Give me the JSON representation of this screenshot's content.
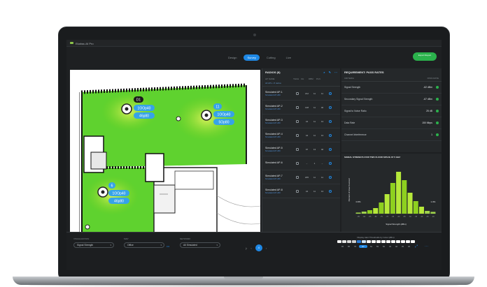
{
  "app": {
    "title": "Ekahau AI Pro"
  },
  "tabs": [
    {
      "label": "Design",
      "active": false
    },
    {
      "label": "Survey",
      "active": true
    },
    {
      "label": "Cutting",
      "active": false
    },
    {
      "label": "Live",
      "active": false
    }
  ],
  "export_label": "Export Report",
  "map": {
    "ap_badges": [
      {
        "tag": "D1",
        "line1": "1OOp40",
        "line2": "46p80"
      },
      {
        "tag": "11",
        "line1": "1OOp40",
        "line2": "5Op80"
      },
      {
        "tag": "6",
        "line1": "1OOp40",
        "line2": "46p80"
      }
    ]
  },
  "radios": {
    "title": "RADIOS (8)",
    "columns": [
      "AP NAME",
      "TECH",
      "CH",
      "DBM",
      "PLN"
    ],
    "group_label": "All APs • 8 radios",
    "items": [
      {
        "name": "Simulated AP-1",
        "sub": "Simulated AP 1-B0",
        "c1": "212",
        "c2": "11",
        "c3": "11"
      },
      {
        "name": "Simulated AP-2",
        "sub": "Simulated AP 1-B0",
        "c1": "148",
        "c2": "11",
        "c3": "40"
      },
      {
        "name": "Simulated AP-3",
        "sub": "Simulated AP 1-B0",
        "c1": "44",
        "c2": "11",
        "c3": "13"
      },
      {
        "name": "Simulated AP-4",
        "sub": "Simulated AP 1-B0",
        "c1": "44",
        "c2": "11",
        "c3": "13"
      },
      {
        "name": "Simulated AP-5",
        "sub": "Simulated AP 1-B0",
        "c1": "97",
        "c2": "13",
        "c3": "40"
      },
      {
        "name": "Simulated AP-6",
        "sub": "",
        "c1": "–",
        "c2": "1",
        "c3": "–"
      },
      {
        "name": "Simulated AP-7",
        "sub": "Simulated AP 1-B0",
        "c1": "205",
        "c2": "11",
        "c3": "11"
      },
      {
        "name": "Simulated AP-8",
        "sub": "Simulated AP 1-B0",
        "c1": "44",
        "c2": "11",
        "c3": "13"
      }
    ]
  },
  "requirements": {
    "title": "REQUIREMENT: PASS RATES",
    "col_left": "CRITERIA",
    "col_right": "PASS RATE",
    "rows": [
      {
        "label": "Signal Strength",
        "value": "-62 dBm"
      },
      {
        "label": "Secondary Signal Strength",
        "value": "-67 dBm"
      },
      {
        "label": "Signal to Noise Ratio",
        "value": "25 dB"
      },
      {
        "label": "Data Rate",
        "value": "150 Mbps"
      },
      {
        "label": "Channel Interference",
        "value": "1"
      }
    ]
  },
  "histogram": {
    "title": "SIGNAL STRENGTH FOR TWO FLOOR SPACE AT 5 GHZ",
    "ylabel": "Percent of Area Covered",
    "xlabel": "Signal Strength (dBm)",
    "labels": [
      "0.8%",
      "1.3%"
    ]
  },
  "chart_data": {
    "type": "bar",
    "title": "SIGNAL STRENGTH FOR TWO FLOOR SPACE AT 5 GHZ",
    "xlabel": "Signal Strength (dBm)",
    "ylabel": "Percent of Area Covered",
    "categories": [
      "-95",
      "-90",
      "-85",
      "-80",
      "-75",
      "-70",
      "-65",
      "-60",
      "-55",
      "-50",
      "-45",
      "-40",
      "-35",
      "-30"
    ],
    "values": [
      0.8,
      1.5,
      2.5,
      4,
      8,
      14,
      22,
      30,
      24,
      15,
      9,
      5,
      2,
      1.3
    ],
    "ylim": [
      0,
      35
    ],
    "grid": false
  },
  "bottom": {
    "visualization_label": "VISUALIZATION",
    "visualization_value": "Signal Strength",
    "map_label": "MAP",
    "map_value": "Office",
    "network_label": "NETWORK",
    "network_value": "All Simulated",
    "page_current": "4",
    "legend_title": "Display Alert Thresholds by Color (dBm)",
    "legend_values": [
      "95",
      "85",
      "75",
      "67",
      "62",
      "55",
      "50",
      "45",
      "40",
      "35",
      "30"
    ],
    "legend_selected": "67",
    "legend_colors": [
      "#f2f2f2",
      "#e6e6e6",
      "#d9d9d9",
      "#cfcfcf",
      "#2b7bd6",
      "#cde3f7",
      "#ffffff",
      "#ffffff",
      "#ffffff",
      "#ffffff",
      "#ffffff",
      "#ffffff",
      "#ffffff",
      "#ffffff",
      "#ffffff",
      "#ffffff"
    ]
  }
}
